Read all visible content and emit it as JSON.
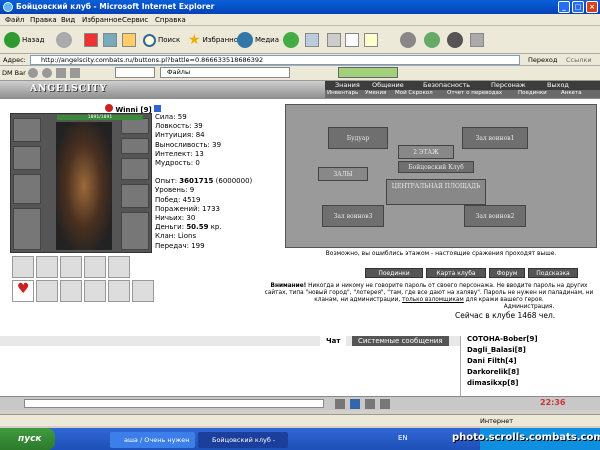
{
  "window": {
    "title": "Бойцовский клуб - Microsoft Internet Explorer"
  },
  "menu": [
    "Файл",
    "Правка",
    "Вид",
    "Избранное",
    "Сервис",
    "Справка"
  ],
  "toolbar": {
    "back": "Назад",
    "search": "Поиск",
    "favorites": "Избранное",
    "media": "Медиа"
  },
  "address": {
    "label": "Адрес:",
    "url": "http://angelscity.combats.ru/buttons.pl?battle=0.866633518686392",
    "go": "Переход",
    "links": "Ссылки"
  },
  "linksbar": {
    "dm": "DM Bar",
    "files": "Файлы"
  },
  "site": {
    "logo": "ANGELSCITY",
    "nav": [
      "Знания",
      "Общение",
      "Безопасность",
      "Персонаж",
      "Выход"
    ],
    "subnav": [
      "Инвентарь",
      "Умения",
      "Мой Скрокол",
      "Отчет о переводах",
      "Поединки",
      "Анкета"
    ]
  },
  "character": {
    "name": "Winni",
    "level": "[9]",
    "hp": "1891/1891",
    "stats": [
      {
        "label": "Сила:",
        "value": "59"
      },
      {
        "label": "Ловкость:",
        "value": "39"
      },
      {
        "label": "Интуиция:",
        "value": "84"
      },
      {
        "label": "Выносливость:",
        "value": "39"
      },
      {
        "label": "Интелект:",
        "value": "13"
      },
      {
        "label": "Мудрость:",
        "value": "0"
      }
    ],
    "experience_label": "Опыт:",
    "experience": "3601715",
    "experience_next": "(6000000)",
    "level_label": "Уровень:",
    "level_value": "9",
    "wins_label": "Побед:",
    "wins": "4519",
    "losses_label": "Поражений:",
    "losses": "1733",
    "draws_label": "Ничьих:",
    "draws": "30",
    "money_label": "Деньги:",
    "money": "50.59",
    "money_unit": "кр.",
    "clan_label": "Клан:",
    "clan": "Lions",
    "transfers_label": "Передач:",
    "transfers": "199"
  },
  "map": {
    "rooms": [
      "Будуар",
      "2 ЭТАЖ",
      "Зал воинов1",
      "Бойцовский Клуб",
      "ЗАЛЫ",
      "ЦЕНТРАЛЬНАЯ ПЛОЩАДЬ",
      "Зал воинов3",
      "Зал воинов2"
    ],
    "caption": "Возможно, вы ошиблись этажом - настоящие сражения проходят выше."
  },
  "buttons": [
    "Поединки",
    "Карта клуба",
    "Форум",
    "Подсказка"
  ],
  "warning": {
    "title": "Внимание!",
    "text": "Никогда и никому не говорите пароль от своего персонажа. Не вводите пароль на других сайтах, типа \"новый город\", \"лотерея\", \"там, где все дают на халяву\". Пароль не нужен ни паладинам, ни кланам, ни администрации,",
    "link": "только взломщикам",
    "tail": "для кражи вашего героя.",
    "sign": "Администрация."
  },
  "online": "Сейчас в клубе 1468 чел.",
  "chat": {
    "tab_chat": "Чат",
    "tab_system": "Системные сообщения"
  },
  "userlist": [
    {
      "name": "COTOHA-Bober",
      "level": "[9]"
    },
    {
      "name": "Dagli_Balasi",
      "level": "[8]"
    },
    {
      "name": "Dani Filth",
      "level": "[4]"
    },
    {
      "name": "Darkorelik",
      "level": "[8]"
    },
    {
      "name": "dimasikxp",
      "level": "[8]"
    }
  ],
  "clock": "22:36",
  "status": {
    "zone": "Интернет"
  },
  "taskbar": {
    "start": "пуск",
    "tasks": [
      "аша / Очень нужен ...",
      "Бойцовский клуб - М..."
    ],
    "lang": "EN",
    "watermark": "photo.scrolls.combats.com"
  }
}
